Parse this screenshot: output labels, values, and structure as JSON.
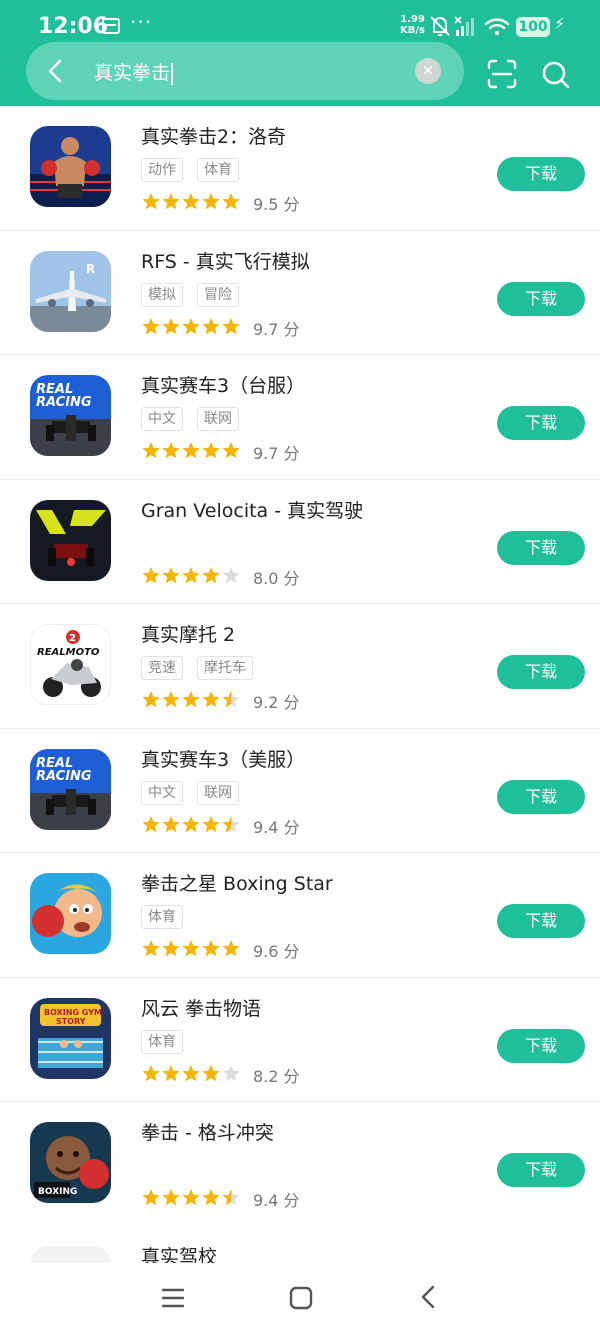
{
  "status_bar": {
    "time": "12:06",
    "more": "···",
    "speed_value": "1.99",
    "speed_unit": "KB/s",
    "battery": "100"
  },
  "search": {
    "query": "真实拳击",
    "clear_glyph": "×"
  },
  "download_label": "下载",
  "score_unit": "分",
  "colors": {
    "accent": "#1fbf9a",
    "star": "#f7b500",
    "star_empty": "#dcdcdc"
  },
  "apps": [
    {
      "title": "真实拳击2：洛奇",
      "tags": [
        "动作",
        "体育"
      ],
      "score": "9.5",
      "stars": 5,
      "icon": "boxer-icon"
    },
    {
      "title": "RFS - 真实飞行模拟",
      "tags": [
        "模拟",
        "冒险"
      ],
      "score": "9.7",
      "stars": 5,
      "icon": "airplane-icon"
    },
    {
      "title": "真实赛车3（台服）",
      "tags": [
        "中文",
        "联网"
      ],
      "score": "9.7",
      "stars": 5,
      "icon": "real-racing-icon"
    },
    {
      "title": "Gran Velocita - 真实驾驶",
      "tags": [],
      "score": "8.0",
      "stars": 4,
      "icon": "racing-car-icon"
    },
    {
      "title": "真实摩托 2",
      "tags": [
        "竞速",
        "摩托车"
      ],
      "score": "9.2",
      "stars": 4.5,
      "icon": "motorbike-icon"
    },
    {
      "title": "真实赛车3（美服）",
      "tags": [
        "中文",
        "联网"
      ],
      "score": "9.4",
      "stars": 4.5,
      "icon": "real-racing-icon"
    },
    {
      "title": "拳击之星 Boxing Star",
      "tags": [
        "体育"
      ],
      "score": "9.6",
      "stars": 5,
      "icon": "boxing-star-icon"
    },
    {
      "title": "风云 拳击物语",
      "tags": [
        "体育"
      ],
      "score": "8.2",
      "stars": 4,
      "icon": "boxing-gym-icon"
    },
    {
      "title": "拳击 - 格斗冲突",
      "tags": [],
      "score": "9.4",
      "stars": 4.5,
      "icon": "boxing-fighter-icon"
    }
  ],
  "partial_app": {
    "title": "真实驾校"
  }
}
